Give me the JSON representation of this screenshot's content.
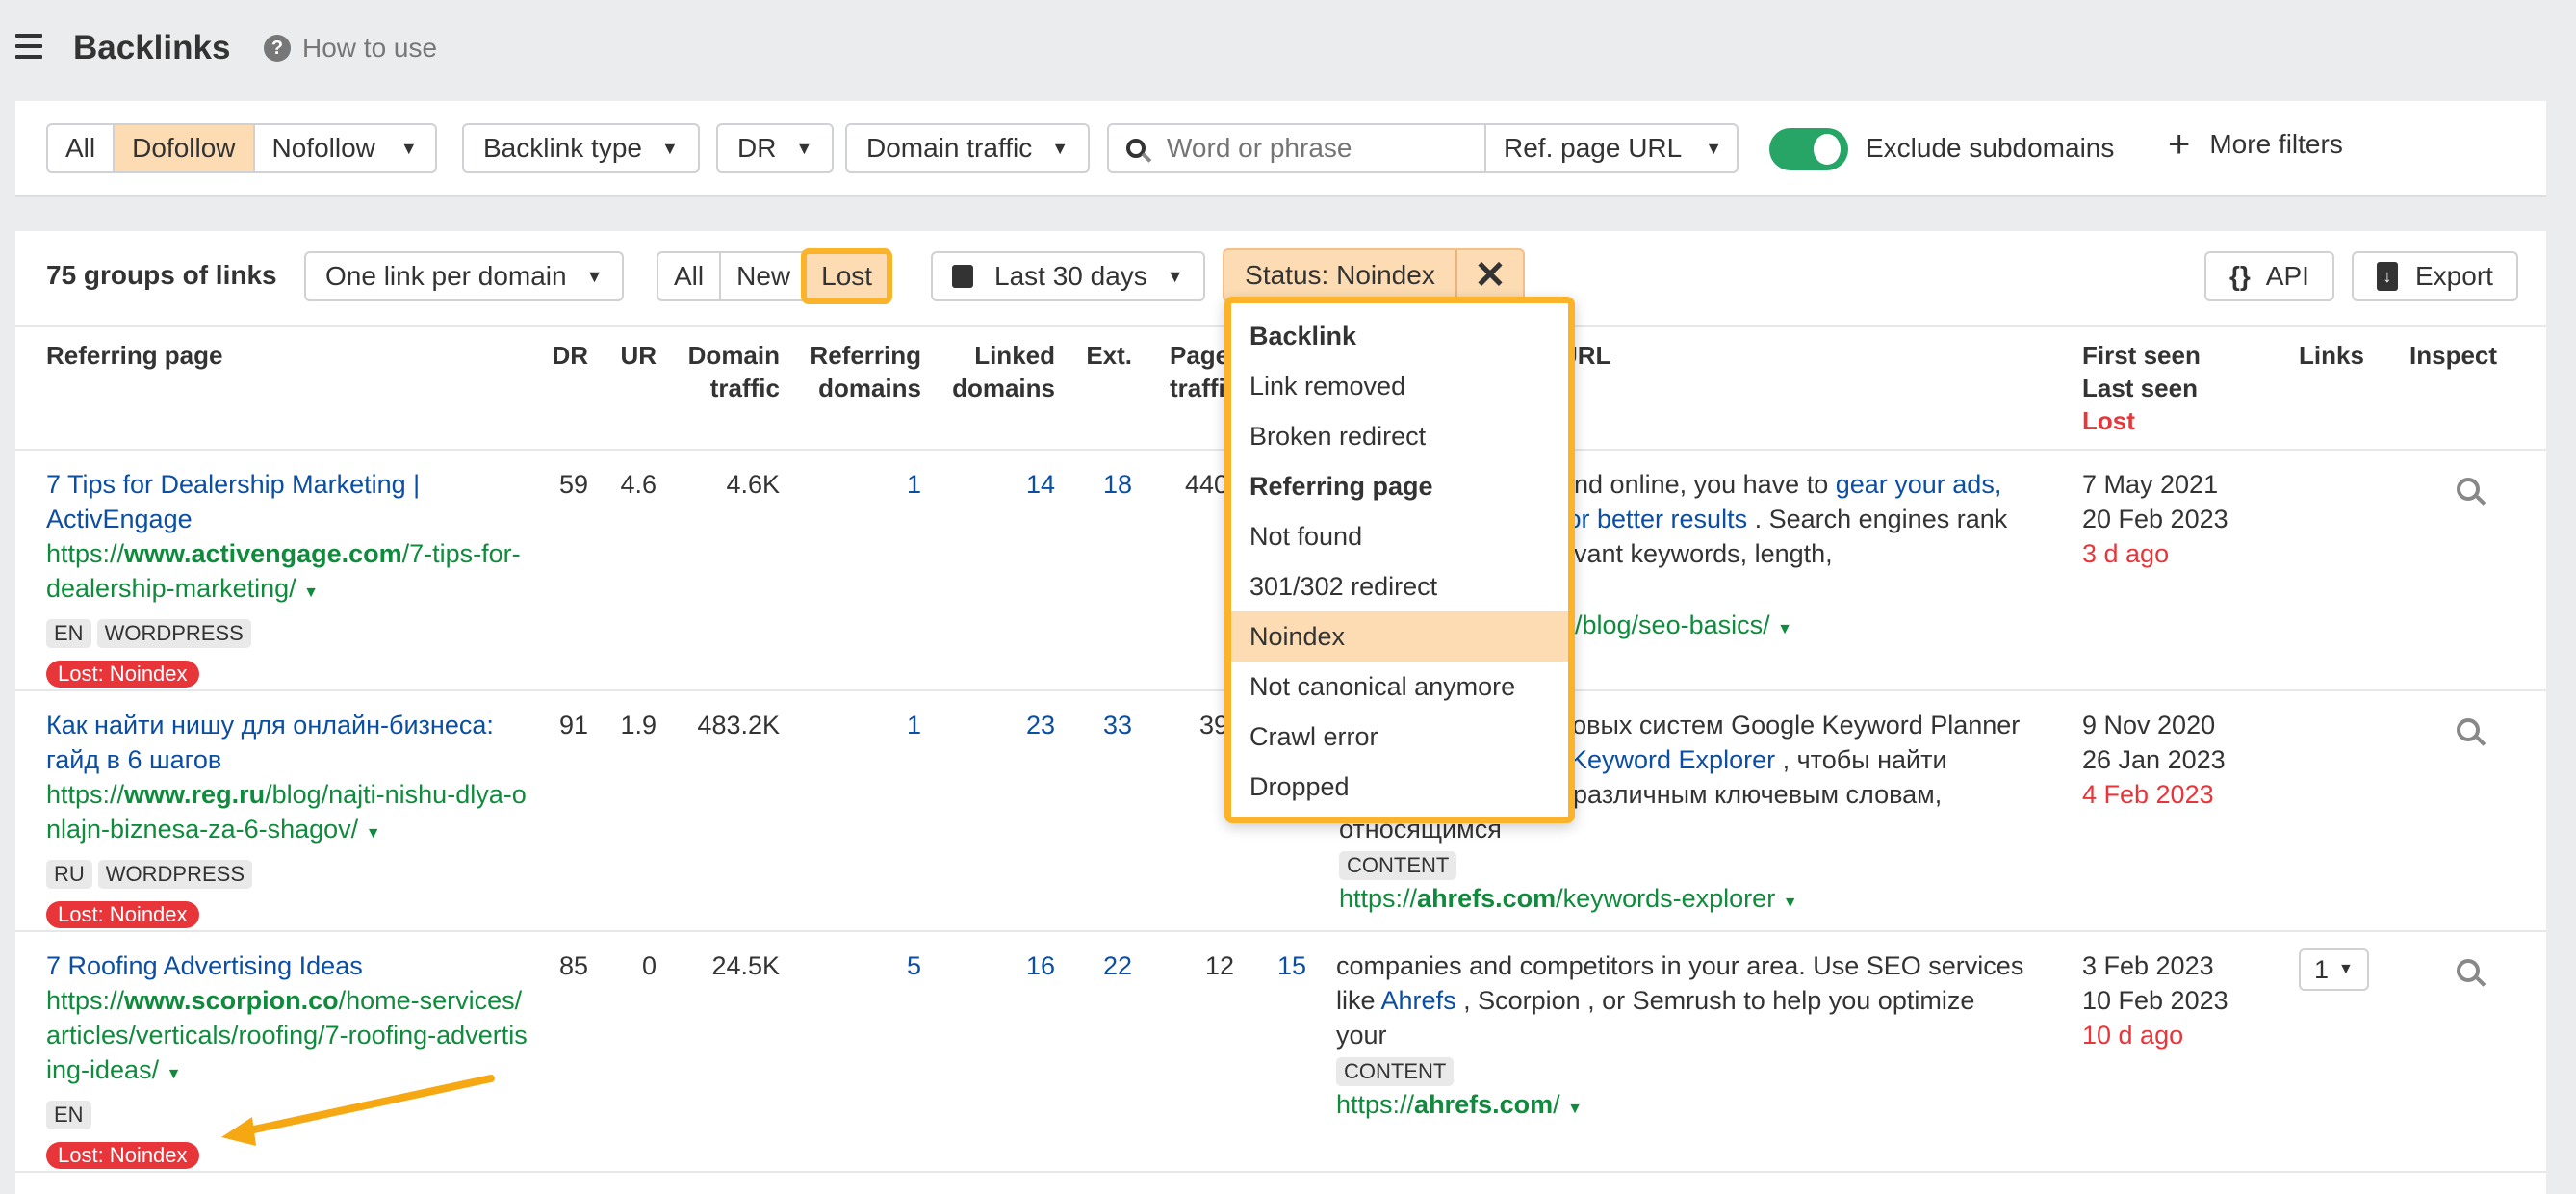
{
  "header": {
    "title": "Backlinks",
    "help_label": "How to use"
  },
  "filters": {
    "link_type": [
      "All",
      "Dofollow",
      "Nofollow"
    ],
    "link_type_selected": "Dofollow",
    "backlink_type": "Backlink type",
    "dr": "DR",
    "domain_traffic": "Domain traffic",
    "search_placeholder": "Word or phrase",
    "search_scope": "Ref. page URL",
    "exclude_subdomains_label": "Exclude subdomains",
    "exclude_subdomains_on": true,
    "more_filters": "More filters"
  },
  "toolbar": {
    "count_label": "75 groups of links",
    "grouping": "One link per domain",
    "status_tabs": [
      "All",
      "New",
      "Lost"
    ],
    "status_selected": "Lost",
    "date_range": "Last 30 days",
    "status_filter": "Status: Noindex",
    "api_label": "API",
    "export_label": "Export"
  },
  "dropdown": {
    "groups": [
      {
        "label": "Backlink",
        "items": [
          "Link removed",
          "Broken redirect"
        ]
      },
      {
        "label": "Referring page",
        "items": [
          "Not found",
          "301/302 redirect",
          "Noindex",
          "Not canonical anymore",
          "Crawl error",
          "Dropped"
        ]
      }
    ],
    "selected": "Noindex"
  },
  "columns": {
    "referring_page": "Referring page",
    "dr": "DR",
    "ur": "UR",
    "domain_traffic_1": "Domain",
    "domain_traffic_2": "traffic",
    "ref_domains_1": "Referring",
    "ref_domains_2": "domains",
    "linked_domains_1": "Linked",
    "linked_domains_2": "domains",
    "ext": "Ext.",
    "page_traffic_1": "Page",
    "page_traffic_2": "traffic",
    "anchor_url": "URL",
    "first_seen": "First seen",
    "last_seen": "Last seen",
    "lost": "Lost",
    "links": "Links",
    "inspect": "Inspect"
  },
  "rows": [
    {
      "title": "7 Tips for Dealership Marketing | ActivEngage",
      "url_prefix": "https://",
      "url_domain": "www.activengage.com",
      "url_path": "/7-tips-for-dealership-marketing/",
      "tags": [
        "EN",
        "WORDPRESS"
      ],
      "status": "Lost: Noindex",
      "dr": "59",
      "ur": "4.6",
      "domain_traffic": "4.6K",
      "ref_domains": "1",
      "linked_domains": "14",
      "ext": "18",
      "page_traffic": "440",
      "anchor_line1_text": "und online, you have to ",
      "anchor_line1_link": "gear your ads,",
      "anchor_line2_link": "for better results",
      "anchor_line2_text": " . Search engines rank",
      "anchor_line3_text": "evant keywords, length,",
      "target_url_path": "/blog/seo-basics/",
      "first_seen": "7 May 2021",
      "last_seen": "20 Feb 2023",
      "lost": "3 d ago"
    },
    {
      "title": "Как найти нишу для онлайн-бизнеса: гайд в 6 шагов",
      "url_prefix": "https://",
      "url_domain": "www.reg.ru",
      "url_path": "/blog/najti-nishu-dlya-onlajn-biznesa-za-6-shagov/",
      "tags": [
        "RU",
        "WORDPRESS"
      ],
      "status": "Lost: Noindex",
      "dr": "91",
      "ur": "1.9",
      "domain_traffic": "483.2K",
      "ref_domains": "1",
      "linked_domains": "23",
      "ext": "33",
      "page_traffic": "39",
      "anchor_line1_text": "ковых систем Google Keyword Planner",
      "anchor_line2_link": "Keyword Explorer",
      "anchor_line2_text": " , чтобы найти",
      "anchor_line3_text": "различным ключевым словам,",
      "anchor_line4_text": "относящимся",
      "anchor_tag": "CONTENT",
      "target_url_prefix": "https://",
      "target_url_domain": "ahrefs.com",
      "target_url_path": "/keywords-explorer",
      "first_seen": "9 Nov 2020",
      "last_seen": "26 Jan 2023",
      "lost": "4 Feb 2023"
    },
    {
      "title": "7 Roofing Advertising Ideas",
      "url_prefix": "https://",
      "url_domain": "www.scorpion.co",
      "url_path": "/home-services/articles/verticals/roofing/7-roofing-advertising-ideas/",
      "tags": [
        "EN"
      ],
      "status": "Lost: Noindex",
      "dr": "85",
      "ur": "0",
      "domain_traffic": "24.5K",
      "ref_domains": "5",
      "linked_domains": "16",
      "ext": "22",
      "page_traffic": "12",
      "keywords": "15",
      "anchor_line1_text": "companies and competitors in your area. Use SEO services",
      "anchor_line2_pre": "like ",
      "anchor_line2_link": "Ahrefs",
      "anchor_line2_text": " , Scorpion , or Semrush to help you optimize",
      "anchor_line3_text": "your",
      "anchor_tag": "CONTENT",
      "target_url_prefix": "https://",
      "target_url_domain": "ahrefs.com",
      "target_url_path": "/",
      "first_seen": "3 Feb 2023",
      "last_seen": "10 Feb 2023",
      "lost": "10 d ago",
      "links_count": "1"
    }
  ],
  "colors": {
    "accent_highlight": "#fbb42a",
    "selected_fill": "#fddcb3",
    "link_blue": "#0b4ea2",
    "url_green": "#108a3d",
    "lost_red": "#e8353a",
    "toggle_green": "#27a566"
  }
}
